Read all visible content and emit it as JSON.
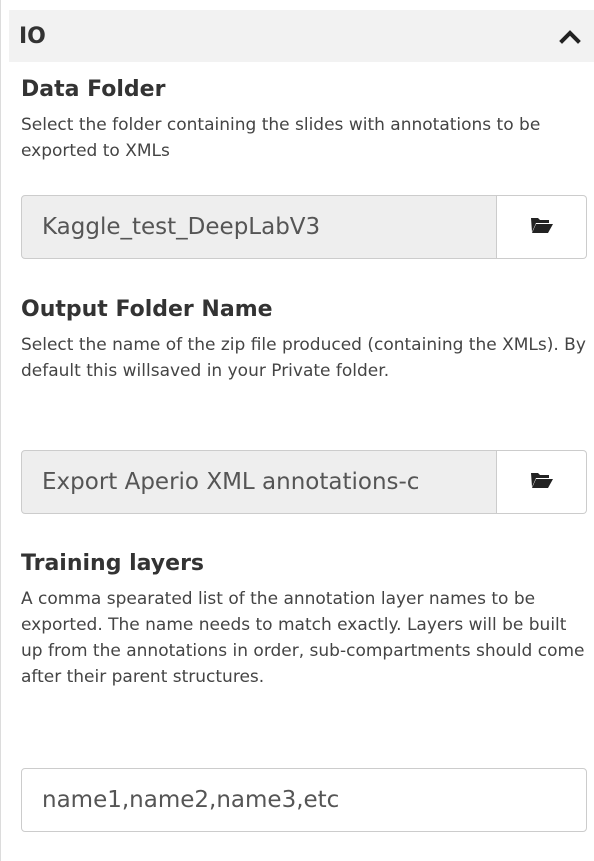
{
  "panel": {
    "title": "IO",
    "collapse_icon": "chevron-up-icon"
  },
  "fields": {
    "data_folder": {
      "label": "Data Folder",
      "description": "Select the folder containing the slides with annotations to be exported to XMLs",
      "value": "Kaggle_test_DeepLabV3",
      "button_icon": "folder-open-icon"
    },
    "output_folder": {
      "label": "Output Folder Name",
      "description": "Select the name of the zip file produced (containing the XMLs). By default this willsaved in your Private folder.",
      "value": "Export Aperio XML annotations-c",
      "button_icon": "folder-open-icon"
    },
    "training_layers": {
      "label": "Training layers",
      "description": "A comma spearated list of the annotation layer names to be exported. The name needs to match exactly. Layers will be built up from the annotations in order, sub-compartments should come after their parent structures.",
      "value": "name1,name2,name3,etc"
    }
  }
}
